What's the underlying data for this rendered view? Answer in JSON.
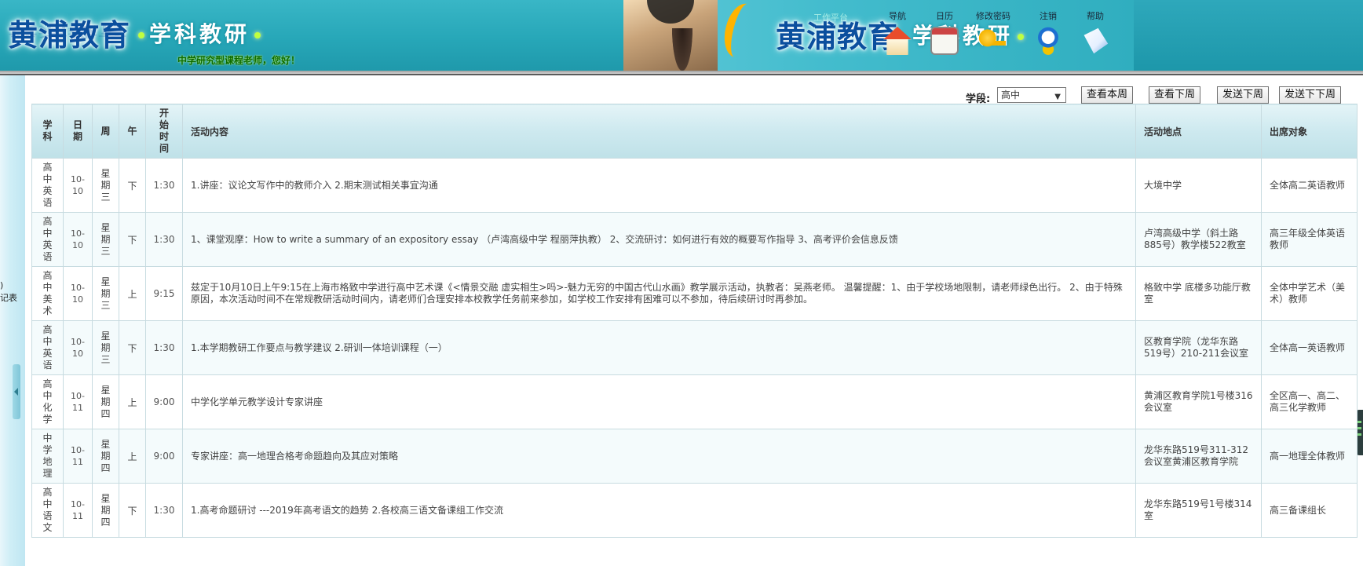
{
  "header": {
    "logo_text": "黄浦教育",
    "subject_text": "学科教研",
    "greeting": "中学研究型课程老师，您好！",
    "faint_text": "工作平台",
    "nav": [
      {
        "label": "导航",
        "icon": "home-icon"
      },
      {
        "label": "日历",
        "icon": "calendar-icon"
      },
      {
        "label": "修改密码",
        "icon": "key-icon"
      },
      {
        "label": "注销",
        "icon": "logout-icon"
      },
      {
        "label": "帮助",
        "icon": "help-icon"
      }
    ]
  },
  "sidebar": {
    "edge_text": ")\n记表"
  },
  "controls": {
    "stage_label": "学段:",
    "stage_value": "高中",
    "buttons": [
      "查看本周",
      "查看下周",
      "发送下周",
      "发送下下周"
    ]
  },
  "table": {
    "headers": [
      "学科",
      "日期",
      "周",
      "午",
      "开始时间",
      "活动内容",
      "活动地点",
      "出席对象"
    ],
    "rows": [
      {
        "subject": "高中英语",
        "date": "10-10",
        "weekday": "星期三",
        "half": "下",
        "time": "1:30",
        "content": "1.讲座：议论文写作中的教师介入 2.期末测试相关事宜沟通",
        "place": "大境中学",
        "audience": "全体高二英语教师"
      },
      {
        "subject": "高中英语",
        "date": "10-10",
        "weekday": "星期三",
        "half": "下",
        "time": "1:30",
        "content": "1、课堂观摩：How to write a summary of an expository essay （卢湾高级中学 程丽萍执教） 2、交流研讨：如何进行有效的概要写作指导 3、高考评价会信息反馈",
        "place": "卢湾高级中学（斜土路885号）教学楼522教室",
        "audience": "高三年级全体英语教师"
      },
      {
        "subject": "高中美术",
        "date": "10-10",
        "weekday": "星期三",
        "half": "上",
        "time": "9:15",
        "content": "兹定于10月10日上午9:15在上海市格致中学进行高中艺术课《<情景交融 虚实相生>吗>-魅力无穷的中国古代山水画》教学展示活动，执教者：吴燕老师。 温馨提醒：1、由于学校场地限制，请老师绿色出行。 2、由于特殊原因，本次活动时间不在常规教研活动时间内，请老师们合理安排本校教学任务前来参加，如学校工作安排有困难可以不参加，待后续研讨时再参加。",
        "place": "格致中学 底楼多功能厅教室",
        "audience": "全体中学艺术（美术）教师"
      },
      {
        "subject": "高中英语",
        "date": "10-10",
        "weekday": "星期三",
        "half": "下",
        "time": "1:30",
        "content": "1.本学期教研工作要点与教学建议 2.研训一体培训课程（一）",
        "place": "区教育学院（龙华东路519号）210-211会议室",
        "audience": "全体高一英语教师"
      },
      {
        "subject": "高中化学",
        "date": "10-11",
        "weekday": "星期四",
        "half": "上",
        "time": "9:00",
        "content": "中学化学单元教学设计专家讲座",
        "place": "黄浦区教育学院1号楼316会议室",
        "audience": "全区高一、高二、高三化学教师"
      },
      {
        "subject": "中学地理",
        "date": "10-11",
        "weekday": "星期四",
        "half": "上",
        "time": "9:00",
        "content": "专家讲座：高一地理合格考命题趋向及其应对策略",
        "place": "龙华东路519号311-312会议室黄浦区教育学院",
        "audience": "高一地理全体教师"
      },
      {
        "subject": "高中语文",
        "date": "10-11",
        "weekday": "星期四",
        "half": "下",
        "time": "1:30",
        "content": "1.高考命题研讨 ---2019年高考语文的趋势 2.各校高三语文备课组工作交流",
        "place": "龙华东路519号1号楼314室",
        "audience": "高三备课组长"
      }
    ]
  }
}
